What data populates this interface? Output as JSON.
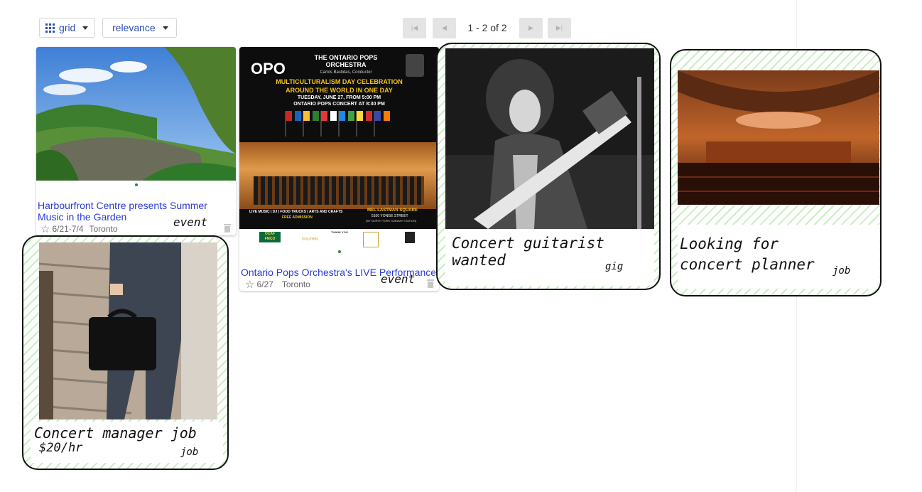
{
  "toolbar": {
    "view_select": {
      "value": "grid",
      "icon": "grid-icon"
    },
    "sort_select": {
      "value": "relevance"
    },
    "pagination": {
      "text": "1 - 2 of 2"
    }
  },
  "cards": [
    {
      "title": "Harbourfront Centre presents Summer Music in the Garden",
      "date": "6/21-7/4",
      "location": "Toronto",
      "tag": "event"
    },
    {
      "title": "Ontario Pops Orchestra's LIVE Performance",
      "date": "6/27",
      "location": "Toronto",
      "tag": "event",
      "poster": {
        "logo": "OPO",
        "org": "THE ONTARIO POPS ORCHESTRA",
        "conductor": "Carlos Bastidas, Conductor",
        "headline_1": "MULTICULTURALISM DAY CELEBRATION",
        "headline_2": "AROUND THE WORLD IN ONE DAY",
        "when_1": "TUESDAY, JUNE 27, FROM 5:00 PM",
        "when_2": "ONTARIO POPS CONCERT AT 8:30 PM",
        "footer_left_1": "LIVE MUSIC | DJ | FOOD TRUCKS | ARTS AND CRAFTS",
        "footer_left_2": "FREE ADMISSION",
        "footer_right_1": "MEL LASTMAN SQUARE",
        "footer_right_2": "5100 YONGE STREET",
        "footer_right_3": "(BY NORTH YORK SUBWAY STATION)",
        "sponsor_1": "OCAF FMCO",
        "sponsor_2": "DOLPHIN",
        "sponsor_thanks": "THANK YOU"
      }
    }
  ],
  "sketches": [
    {
      "title": "Concert guitarist wanted",
      "tag": "gig"
    },
    {
      "title": "Looking for concert planner",
      "tag": "job"
    },
    {
      "title": "Concert manager job",
      "subtitle": "$20/hr",
      "tag": "job"
    }
  ],
  "colors": {
    "link": "#2a3ad8",
    "accent_stripes": "#c9eec2",
    "button_disabled": "#e4e4e4"
  }
}
